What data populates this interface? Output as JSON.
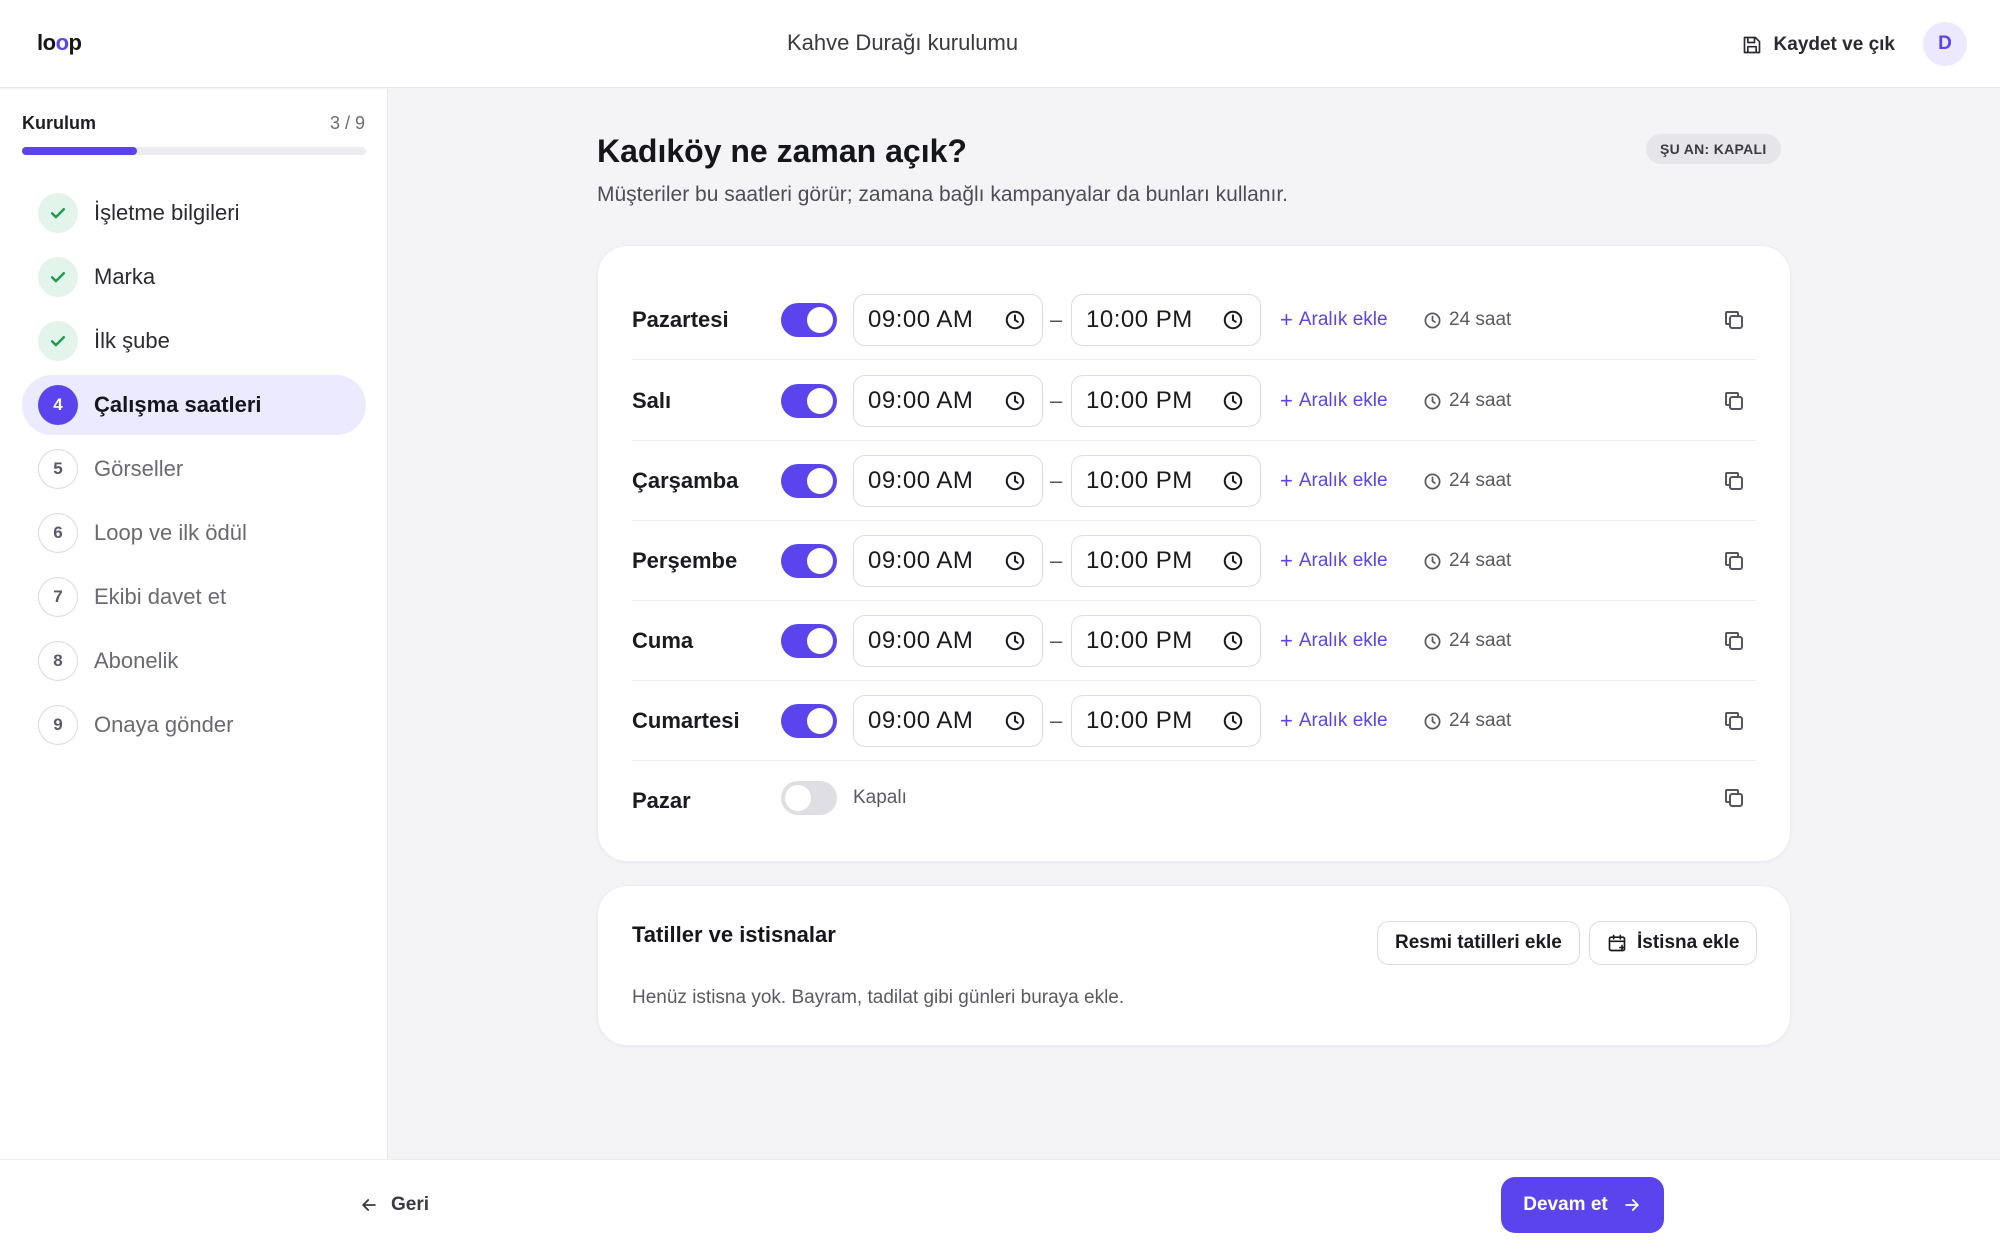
{
  "header": {
    "logo": "loop",
    "title": "Kahve Durağı kurulumu",
    "save_exit": "Kaydet ve çık",
    "avatar": "D"
  },
  "sidebar": {
    "title": "Kurulum",
    "counter": "3 / 9",
    "progress": 0.333,
    "steps": [
      {
        "num": "✓",
        "label": "İşletme bilgileri",
        "state": "done"
      },
      {
        "num": "✓",
        "label": "Marka",
        "state": "done"
      },
      {
        "num": "✓",
        "label": "İlk şube",
        "state": "done"
      },
      {
        "num": "4",
        "label": "Çalışma saatleri",
        "state": "active"
      },
      {
        "num": "5",
        "label": "Görseller",
        "state": "todo"
      },
      {
        "num": "6",
        "label": "Loop ve ilk ödül",
        "state": "todo"
      },
      {
        "num": "7",
        "label": "Ekibi davet et",
        "state": "todo"
      },
      {
        "num": "8",
        "label": "Abonelik",
        "state": "todo"
      },
      {
        "num": "9",
        "label": "Onaya gönder",
        "state": "todo"
      }
    ]
  },
  "main": {
    "title": "Kadıköy ne zaman açık?",
    "subtitle": "Müşteriler bu saatleri görür; zamana bağlı kampanyalar da bunları kullanır.",
    "status": "ŞU AN: KAPALI",
    "days": [
      {
        "name": "Pazartesi",
        "open": true,
        "from": "09:00  AM",
        "to": "10:00  PM",
        "add": "Aralık ekle",
        "duration": "24 saat"
      },
      {
        "name": "Salı",
        "open": true,
        "from": "09:00  AM",
        "to": "10:00  PM",
        "add": "Aralık ekle",
        "duration": "24 saat"
      },
      {
        "name": "Çarşamba",
        "open": true,
        "from": "09:00  AM",
        "to": "10:00  PM",
        "add": "Aralık ekle",
        "duration": "24 saat"
      },
      {
        "name": "Perşembe",
        "open": true,
        "from": "09:00  AM",
        "to": "10:00  PM",
        "add": "Aralık ekle",
        "duration": "24 saat"
      },
      {
        "name": "Cuma",
        "open": true,
        "from": "09:00  AM",
        "to": "10:00  PM",
        "add": "Aralık ekle",
        "duration": "24 saat"
      },
      {
        "name": "Cumartesi",
        "open": true,
        "from": "09:00  AM",
        "to": "10:00  PM",
        "add": "Aralık ekle",
        "duration": "24 saat"
      },
      {
        "name": "Pazar",
        "open": false,
        "closed_label": "Kapalı"
      }
    ],
    "holidays": {
      "title": "Tatiller ve istisnalar",
      "add_public": "Resmi tatilleri ekle",
      "add_exception": "İstisna ekle",
      "empty": "Henüz istisna yok. Bayram, tadilat gibi günleri buraya ekle."
    }
  },
  "footer": {
    "back": "Geri",
    "continue": "Devam et"
  },
  "colors": {
    "accent": "#5b43ee",
    "done": "#1f9d55"
  }
}
